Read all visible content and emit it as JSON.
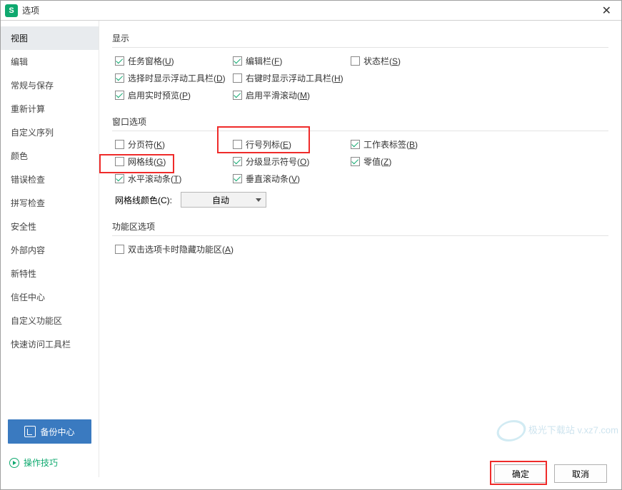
{
  "title": "选项",
  "sidebar": {
    "items": [
      {
        "label": "视图"
      },
      {
        "label": "编辑"
      },
      {
        "label": "常规与保存"
      },
      {
        "label": "重新计算"
      },
      {
        "label": "自定义序列"
      },
      {
        "label": "颜色"
      },
      {
        "label": "错误检查"
      },
      {
        "label": "拼写检查"
      },
      {
        "label": "安全性"
      },
      {
        "label": "外部内容"
      },
      {
        "label": "新特性"
      },
      {
        "label": "信任中心"
      },
      {
        "label": "自定义功能区"
      },
      {
        "label": "快速访问工具栏"
      }
    ],
    "backup": "备份中心",
    "tips": "操作技巧"
  },
  "sections": {
    "display": "显示",
    "window": "窗口选项",
    "ribbon": "功能区选项"
  },
  "display": {
    "task_pane": {
      "text": "任务窗格(",
      "u": "U",
      "suffix": ")"
    },
    "edit_bar": {
      "text": "编辑栏(",
      "u": "F",
      "suffix": ")"
    },
    "status_bar": {
      "text": "状态栏(",
      "u": "S",
      "suffix": ")"
    },
    "float_select": {
      "text": "选择时显示浮动工具栏(",
      "u": "D",
      "suffix": ")"
    },
    "float_right": {
      "text": "右键时显示浮动工具栏(",
      "u": "H",
      "suffix": ")"
    },
    "realtime": {
      "text": "启用实时预览(",
      "u": "P",
      "suffix": ")"
    },
    "smooth": {
      "text": "启用平滑滚动(",
      "u": "M",
      "suffix": ")"
    }
  },
  "window": {
    "page_break": {
      "text": "分页符(",
      "u": "K",
      "suffix": ")"
    },
    "row_col": {
      "text": "行号列标(",
      "u": "E",
      "suffix": ")"
    },
    "sheet_tab": {
      "text": "工作表标签(",
      "u": "B",
      "suffix": ")"
    },
    "gridlines": {
      "text": "网格线(",
      "u": "G",
      "suffix": ")"
    },
    "outline": {
      "text": "分级显示符号(",
      "u": "O",
      "suffix": ")"
    },
    "zero": {
      "text": "零值(",
      "u": "Z",
      "suffix": ")"
    },
    "hscroll": {
      "text": "水平滚动条(",
      "u": "T",
      "suffix": ")"
    },
    "vscroll": {
      "text": "垂直滚动条(",
      "u": "V",
      "suffix": ")"
    }
  },
  "gridcolor": {
    "label": {
      "text": "网格线颜色(",
      "u": "C",
      "suffix": "):"
    },
    "value": "自动"
  },
  "ribbon": {
    "dblclick": {
      "text": "双击选项卡时隐藏功能区(",
      "u": "A",
      "suffix": ")"
    }
  },
  "buttons": {
    "ok": "确定",
    "cancel": "取消"
  },
  "watermark": "极光下载站\n v.xz7.com"
}
